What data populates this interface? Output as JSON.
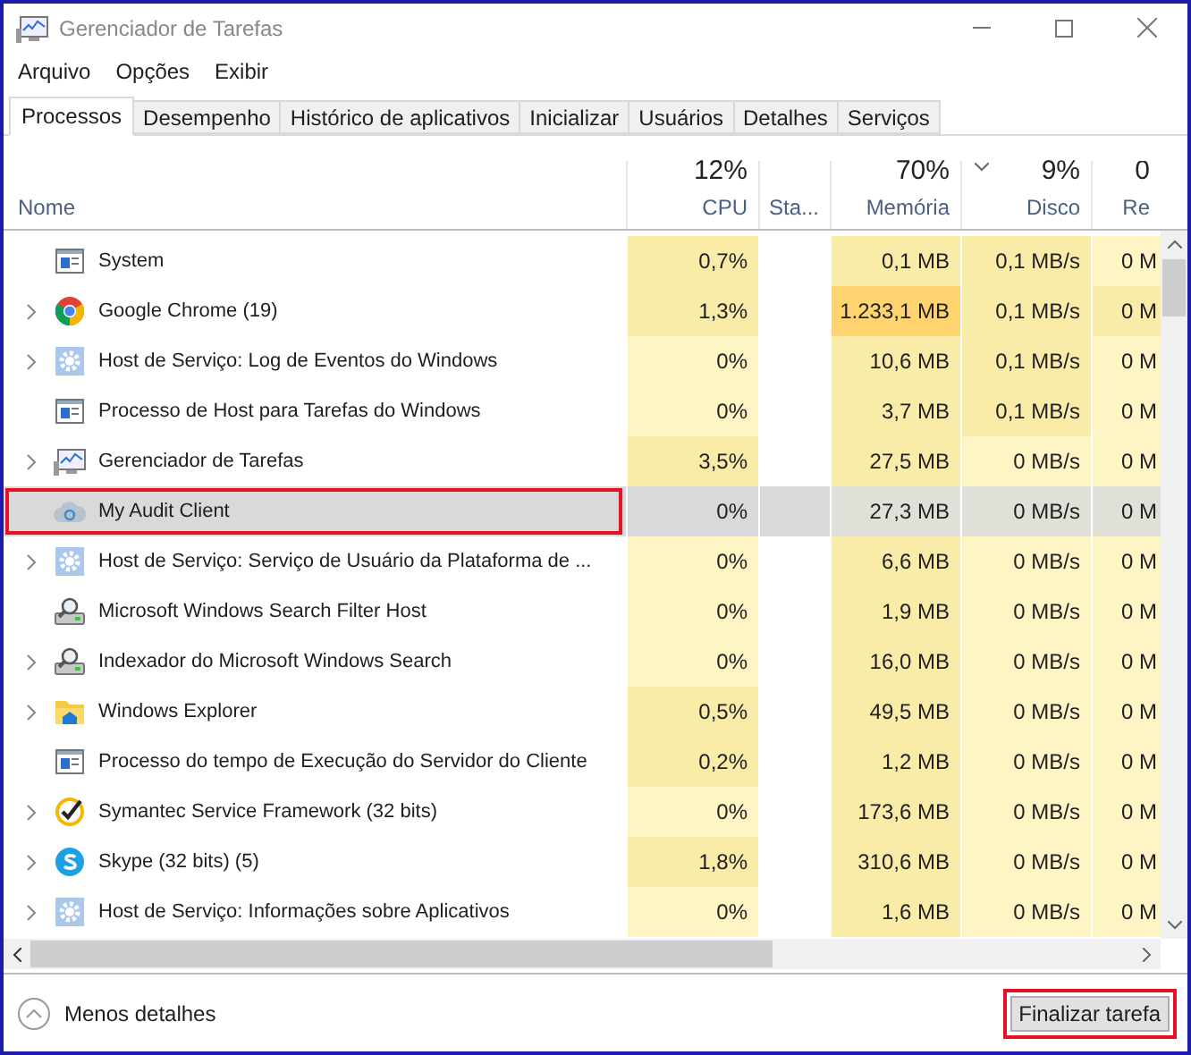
{
  "window": {
    "title": "Gerenciador de Tarefas"
  },
  "menu": [
    "Arquivo",
    "Opções",
    "Exibir"
  ],
  "tabs": [
    {
      "label": "Processos",
      "selected": true
    },
    {
      "label": "Desempenho",
      "selected": false
    },
    {
      "label": "Histórico de aplicativos",
      "selected": false
    },
    {
      "label": "Inicializar",
      "selected": false
    },
    {
      "label": "Usuários",
      "selected": false
    },
    {
      "label": "Detalhes",
      "selected": false
    },
    {
      "label": "Serviços",
      "selected": false
    }
  ],
  "columns": [
    {
      "label": "Nome"
    },
    {
      "usage": "12%",
      "label": "CPU",
      "sorted": false
    },
    {
      "label": "Sta...",
      "sorted": false
    },
    {
      "usage": "70%",
      "label": "Memória",
      "sorted": false
    },
    {
      "usage": "9%",
      "label": "Disco",
      "sorted": true
    },
    {
      "usage": "0",
      "label": "Re",
      "sorted": false
    }
  ],
  "rows": [
    {
      "name": "System",
      "kind": "window",
      "expandable": false,
      "selected": false,
      "highlighted": false,
      "cells": [
        {
          "text": "0,7%",
          "color": "#f9eca8"
        },
        {
          "text": "0,1 MB",
          "color": "#f9eca8"
        },
        {
          "text": "0,1 MB/s",
          "color": "#f9eca8"
        },
        {
          "text": "0 M",
          "color": "#fff4c4"
        }
      ]
    },
    {
      "name": "Google Chrome (19)",
      "kind": "chrome",
      "expandable": true,
      "selected": false,
      "highlighted": false,
      "cells": [
        {
          "text": "1,3%",
          "color": "#f9eca8"
        },
        {
          "text": "1.233,1 MB",
          "color": "#ffd36d"
        },
        {
          "text": "0,1 MB/s",
          "color": "#f9eca8"
        },
        {
          "text": "0 M",
          "color": "#f9eca8"
        }
      ]
    },
    {
      "name": "Host de Serviço: Log de Eventos do Windows",
      "kind": "gear",
      "expandable": true,
      "selected": false,
      "highlighted": false,
      "cells": [
        {
          "text": "0%",
          "color": "#fff4c4"
        },
        {
          "text": "10,6 MB",
          "color": "#f9eca8"
        },
        {
          "text": "0,1 MB/s",
          "color": "#f9eca8"
        },
        {
          "text": "0 M",
          "color": "#fff4c4"
        }
      ]
    },
    {
      "name": "Processo de Host para Tarefas do Windows",
      "kind": "window",
      "expandable": false,
      "selected": false,
      "highlighted": false,
      "cells": [
        {
          "text": "0%",
          "color": "#fff4c4"
        },
        {
          "text": "3,7 MB",
          "color": "#f9eca8"
        },
        {
          "text": "0,1 MB/s",
          "color": "#f9eca8"
        },
        {
          "text": "0 M",
          "color": "#fff4c4"
        }
      ]
    },
    {
      "name": "Gerenciador de Tarefas",
      "kind": "monitor",
      "expandable": true,
      "selected": false,
      "highlighted": false,
      "cells": [
        {
          "text": "3,5%",
          "color": "#f9eca8"
        },
        {
          "text": "27,5 MB",
          "color": "#f9eca8"
        },
        {
          "text": "0 MB/s",
          "color": "#fff4c4"
        },
        {
          "text": "0 M",
          "color": "#fff4c4"
        }
      ]
    },
    {
      "name": "My Audit Client",
      "kind": "cloud",
      "expandable": false,
      "selected": true,
      "highlighted": true,
      "cells": [
        {
          "text": "0%",
          "color": "#d9d9d9"
        },
        {
          "text": "27,3 MB",
          "color": "#e0e0d8"
        },
        {
          "text": "0 MB/s",
          "color": "#e0e0d8"
        },
        {
          "text": "0 M",
          "color": "#e0e0d8"
        }
      ]
    },
    {
      "name": "Host de Serviço: Serviço de Usuário da Plataforma de ...",
      "kind": "gear",
      "expandable": true,
      "selected": false,
      "highlighted": false,
      "cells": [
        {
          "text": "0%",
          "color": "#fff4c4"
        },
        {
          "text": "6,6 MB",
          "color": "#f9eca8"
        },
        {
          "text": "0 MB/s",
          "color": "#fff4c4"
        },
        {
          "text": "0 M",
          "color": "#fff4c4"
        }
      ]
    },
    {
      "name": "Microsoft Windows Search Filter Host",
      "kind": "search",
      "expandable": false,
      "selected": false,
      "highlighted": false,
      "cells": [
        {
          "text": "0%",
          "color": "#fff4c4"
        },
        {
          "text": "1,9 MB",
          "color": "#f9eca8"
        },
        {
          "text": "0 MB/s",
          "color": "#fff4c4"
        },
        {
          "text": "0 M",
          "color": "#fff4c4"
        }
      ]
    },
    {
      "name": "Indexador do Microsoft Windows Search",
      "kind": "search",
      "expandable": true,
      "selected": false,
      "highlighted": false,
      "cells": [
        {
          "text": "0%",
          "color": "#fff4c4"
        },
        {
          "text": "16,0 MB",
          "color": "#f9eca8"
        },
        {
          "text": "0 MB/s",
          "color": "#fff4c4"
        },
        {
          "text": "0 M",
          "color": "#fff4c4"
        }
      ]
    },
    {
      "name": "Windows Explorer",
      "kind": "folder",
      "expandable": true,
      "selected": false,
      "highlighted": false,
      "cells": [
        {
          "text": "0,5%",
          "color": "#f9eca8"
        },
        {
          "text": "49,5 MB",
          "color": "#f9eca8"
        },
        {
          "text": "0 MB/s",
          "color": "#fff4c4"
        },
        {
          "text": "0 M",
          "color": "#fff4c4"
        }
      ]
    },
    {
      "name": "Processo do tempo de Execução do Servidor do Cliente",
      "kind": "window",
      "expandable": false,
      "selected": false,
      "highlighted": false,
      "cells": [
        {
          "text": "0,2%",
          "color": "#f9eca8"
        },
        {
          "text": "1,2 MB",
          "color": "#f9eca8"
        },
        {
          "text": "0 MB/s",
          "color": "#fff4c4"
        },
        {
          "text": "0 M",
          "color": "#fff4c4"
        }
      ]
    },
    {
      "name": "Symantec Service Framework (32 bits)",
      "kind": "check",
      "expandable": true,
      "selected": false,
      "highlighted": false,
      "cells": [
        {
          "text": "0%",
          "color": "#fff4c4"
        },
        {
          "text": "173,6 MB",
          "color": "#f9eca8"
        },
        {
          "text": "0 MB/s",
          "color": "#fff4c4"
        },
        {
          "text": "0 M",
          "color": "#fff4c4"
        }
      ]
    },
    {
      "name": "Skype (32 bits) (5)",
      "kind": "skype",
      "expandable": true,
      "selected": false,
      "highlighted": false,
      "cells": [
        {
          "text": "1,8%",
          "color": "#f9eca8"
        },
        {
          "text": "310,6 MB",
          "color": "#f9eca8"
        },
        {
          "text": "0 MB/s",
          "color": "#fff4c4"
        },
        {
          "text": "0 M",
          "color": "#fff4c4"
        }
      ]
    },
    {
      "name": "Host de Serviço: Informações sobre Aplicativos",
      "kind": "gear",
      "expandable": true,
      "selected": false,
      "highlighted": false,
      "cells": [
        {
          "text": "0%",
          "color": "#fff4c4"
        },
        {
          "text": "1,6 MB",
          "color": "#f9eca8"
        },
        {
          "text": "0 MB/s",
          "color": "#fff4c4"
        },
        {
          "text": "0 M",
          "color": "#fff4c4"
        }
      ]
    }
  ],
  "footer": {
    "details_link": "Menos detalhes",
    "end_task": {
      "label": "Finalizar tarefa",
      "highlighted": true
    }
  }
}
